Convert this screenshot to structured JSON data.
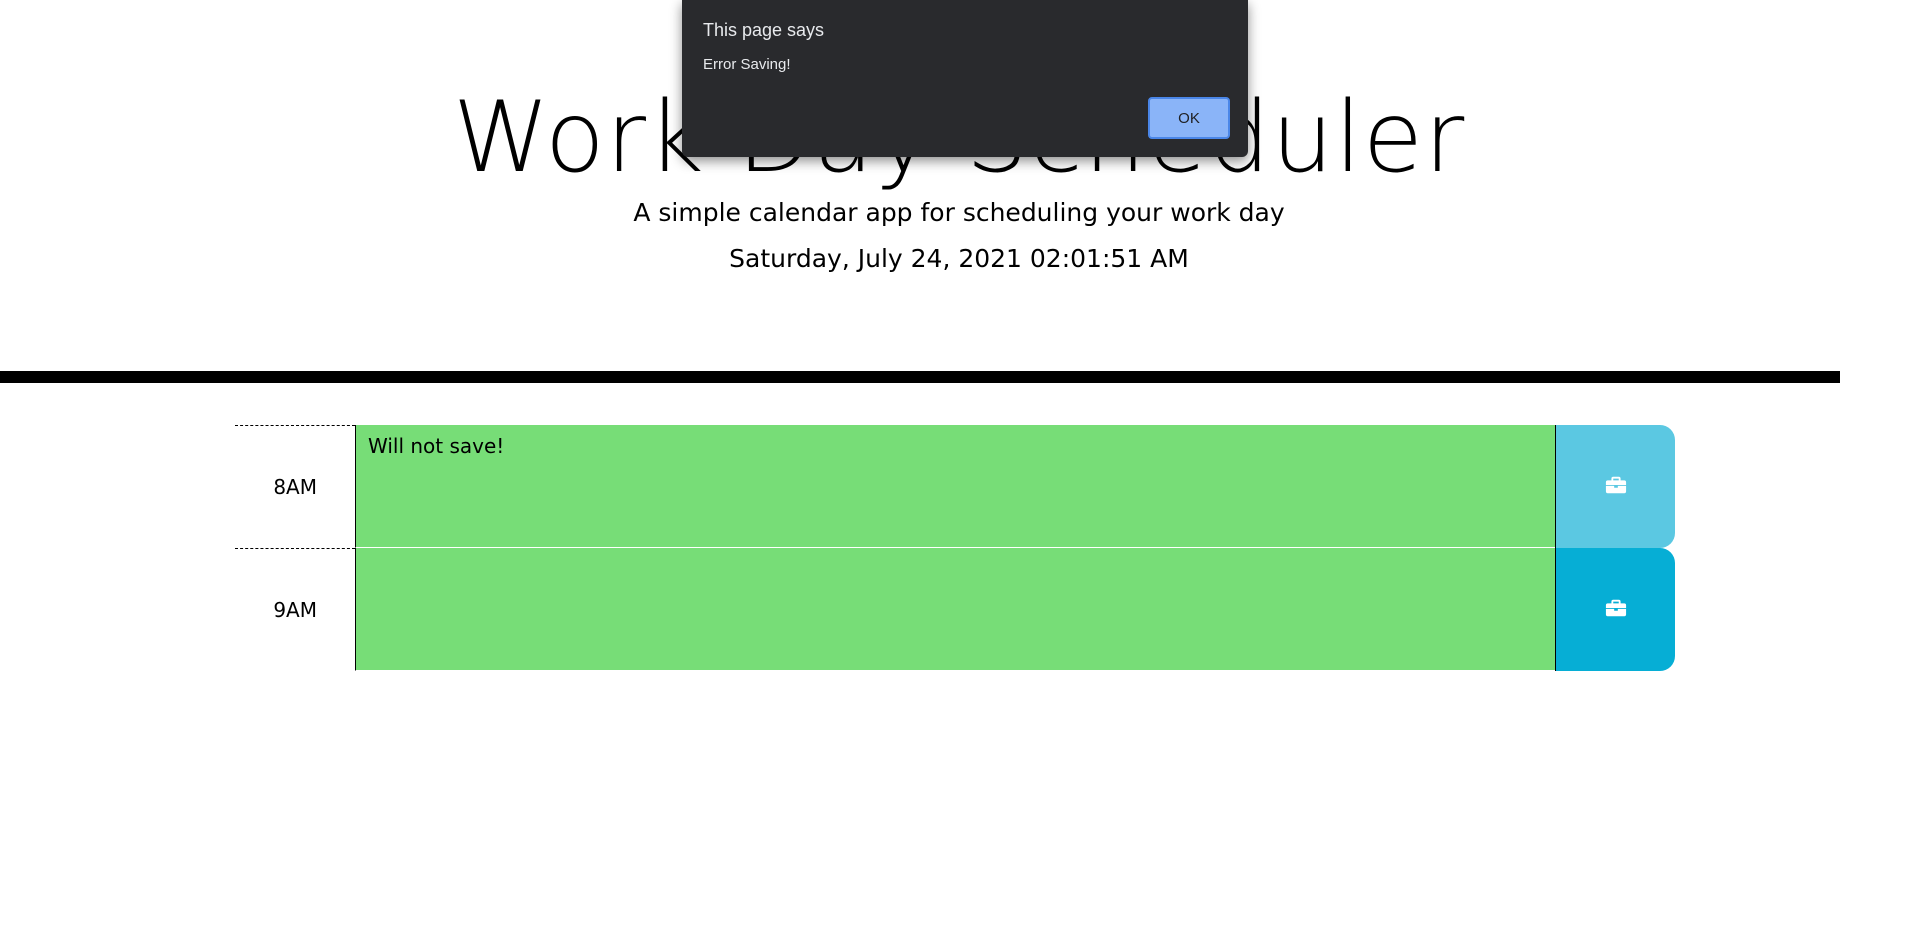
{
  "header": {
    "title": "Work Day Scheduler",
    "lead": "A simple calendar app for scheduling your work day",
    "current_day": "Saturday, July 24, 2021 02:01:51 AM"
  },
  "time_blocks": [
    {
      "hour": "8AM",
      "description": "Will not save!",
      "save_icon": "briefcase-icon"
    },
    {
      "hour": "9AM",
      "description": "",
      "save_icon": "briefcase-icon"
    }
  ],
  "colors": {
    "present_block": "#77dd77",
    "save_button_light": "#5bc8e2",
    "save_button": "#06aed5",
    "dialog_bg": "#292a2d",
    "ok_button": "#8ab4f8"
  },
  "alert_dialog": {
    "title": "This page says",
    "message": "Error Saving!",
    "ok_label": "OK"
  }
}
